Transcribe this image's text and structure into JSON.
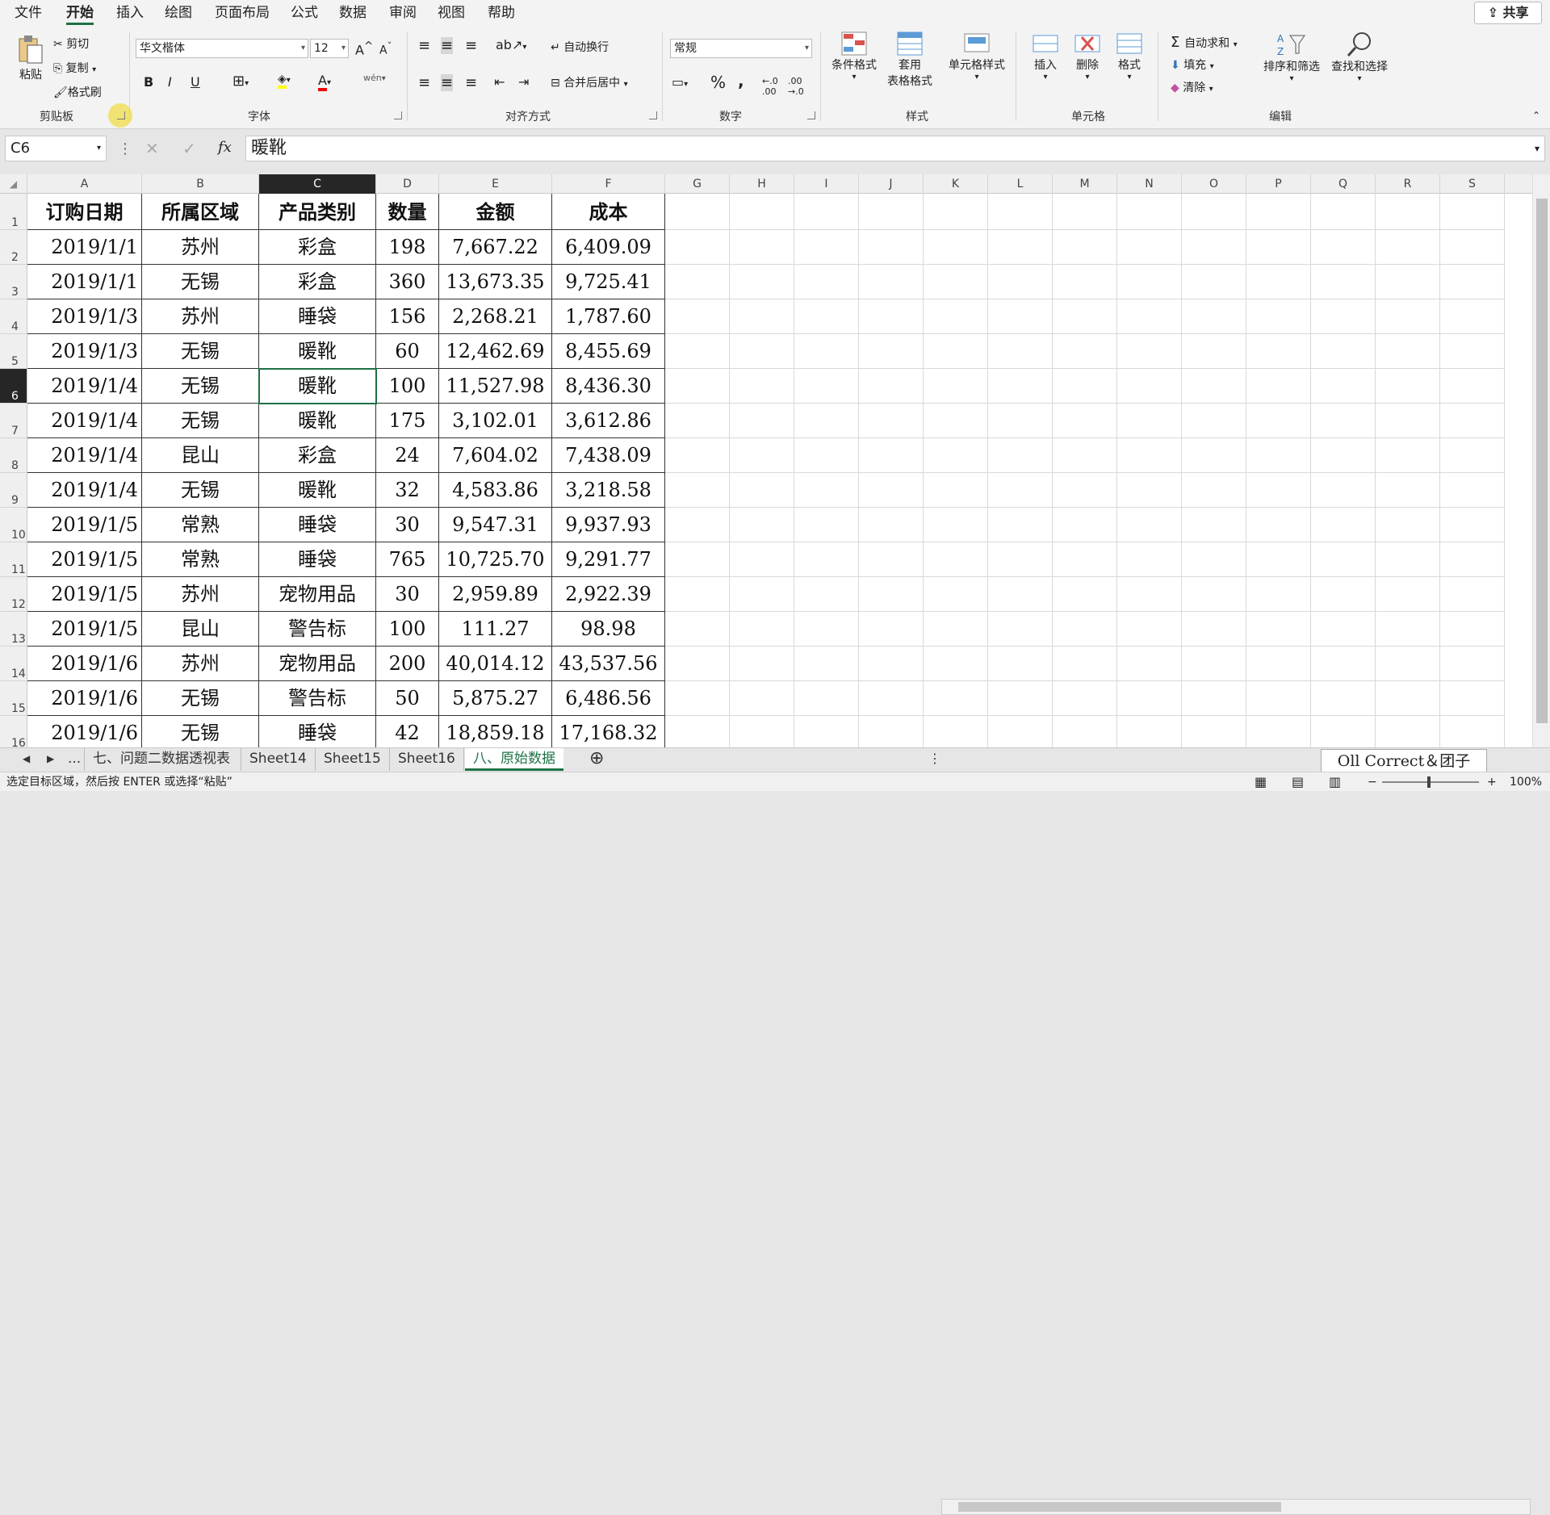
{
  "menu": {
    "items": [
      "文件",
      "开始",
      "插入",
      "绘图",
      "页面布局",
      "公式",
      "数据",
      "审阅",
      "视图",
      "帮助"
    ],
    "active": "开始",
    "share_label": "共享"
  },
  "ribbon": {
    "clipboard": {
      "paste": "粘贴",
      "cut": "剪切",
      "copy": "复制",
      "format_painter": "格式刷",
      "label": "剪贴板"
    },
    "font": {
      "name": "华文楷体",
      "size": "12",
      "label": "字体",
      "bold": "B",
      "italic": "I",
      "underline": "U",
      "phonetic": "wén"
    },
    "alignment": {
      "wrap": "自动换行",
      "merge": "合并后居中",
      "label": "对齐方式"
    },
    "number": {
      "format": "常规",
      "label": "数字",
      "percent": "%",
      "comma": ","
    },
    "styles": {
      "conditional": "条件格式",
      "table_line1": "套用",
      "table_line2": "表格格式",
      "cell_style": "单元格样式",
      "label": "样式"
    },
    "cells": {
      "insert": "插入",
      "delete": "删除",
      "format": "格式",
      "label": "单元格"
    },
    "editing": {
      "autosum": "自动求和",
      "fill": "填充",
      "clear": "清除",
      "sort_filter": "排序和筛选",
      "find_select": "查找和选择",
      "label": "编辑"
    }
  },
  "formula_bar": {
    "name_box": "C6",
    "content": "暖靴",
    "fx": "fx"
  },
  "sheet": {
    "columns": [
      "A",
      "B",
      "C",
      "D",
      "E",
      "F",
      "G",
      "H",
      "I",
      "J",
      "K",
      "L",
      "M",
      "N",
      "O",
      "P",
      "Q",
      "R",
      "S"
    ],
    "selected_column": "C",
    "selected_row": "6",
    "active_cell": "C6",
    "header_row": [
      "订购日期",
      "所属区域",
      "产品类别",
      "数量",
      "金额",
      "成本"
    ],
    "rows": [
      [
        "2019/1/1",
        "苏州",
        "彩盒",
        "198",
        "7,667.22",
        "6,409.09"
      ],
      [
        "2019/1/1",
        "无锡",
        "彩盒",
        "360",
        "13,673.35",
        "9,725.41"
      ],
      [
        "2019/1/3",
        "苏州",
        "睡袋",
        "156",
        "2,268.21",
        "1,787.60"
      ],
      [
        "2019/1/3",
        "无锡",
        "暖靴",
        "60",
        "12,462.69",
        "8,455.69"
      ],
      [
        "2019/1/4",
        "无锡",
        "暖靴",
        "100",
        "11,527.98",
        "8,436.30"
      ],
      [
        "2019/1/4",
        "无锡",
        "暖靴",
        "175",
        "3,102.01",
        "3,612.86"
      ],
      [
        "2019/1/4",
        "昆山",
        "彩盒",
        "24",
        "7,604.02",
        "7,438.09"
      ],
      [
        "2019/1/4",
        "无锡",
        "暖靴",
        "32",
        "4,583.86",
        "3,218.58"
      ],
      [
        "2019/1/5",
        "常熟",
        "睡袋",
        "30",
        "9,547.31",
        "9,937.93"
      ],
      [
        "2019/1/5",
        "常熟",
        "睡袋",
        "765",
        "10,725.70",
        "9,291.77"
      ],
      [
        "2019/1/5",
        "苏州",
        "宠物用品",
        "30",
        "2,959.89",
        "2,922.39"
      ],
      [
        "2019/1/5",
        "昆山",
        "警告标",
        "100",
        "111.27",
        "98.98"
      ],
      [
        "2019/1/6",
        "苏州",
        "宠物用品",
        "200",
        "40,014.12",
        "43,537.56"
      ],
      [
        "2019/1/6",
        "无锡",
        "警告标",
        "50",
        "5,875.27",
        "6,486.56"
      ],
      [
        "2019/1/6",
        "无锡",
        "睡袋",
        "42",
        "18,859.18",
        "17,168.32"
      ]
    ]
  },
  "tabs": {
    "items": [
      "七、问题二数据透视表",
      "Sheet14",
      "Sheet15",
      "Sheet16",
      "八、原始数据"
    ],
    "active": "八、原始数据",
    "ellipsis": "..."
  },
  "status": {
    "message": "选定目标区域，然后按 ENTER 或选择“粘贴”",
    "zoom": "100%"
  },
  "watermark": {
    "text": "Oll Correct＆团子"
  },
  "colors": {
    "accent": "#1e7145",
    "selected_header": "#262626"
  }
}
